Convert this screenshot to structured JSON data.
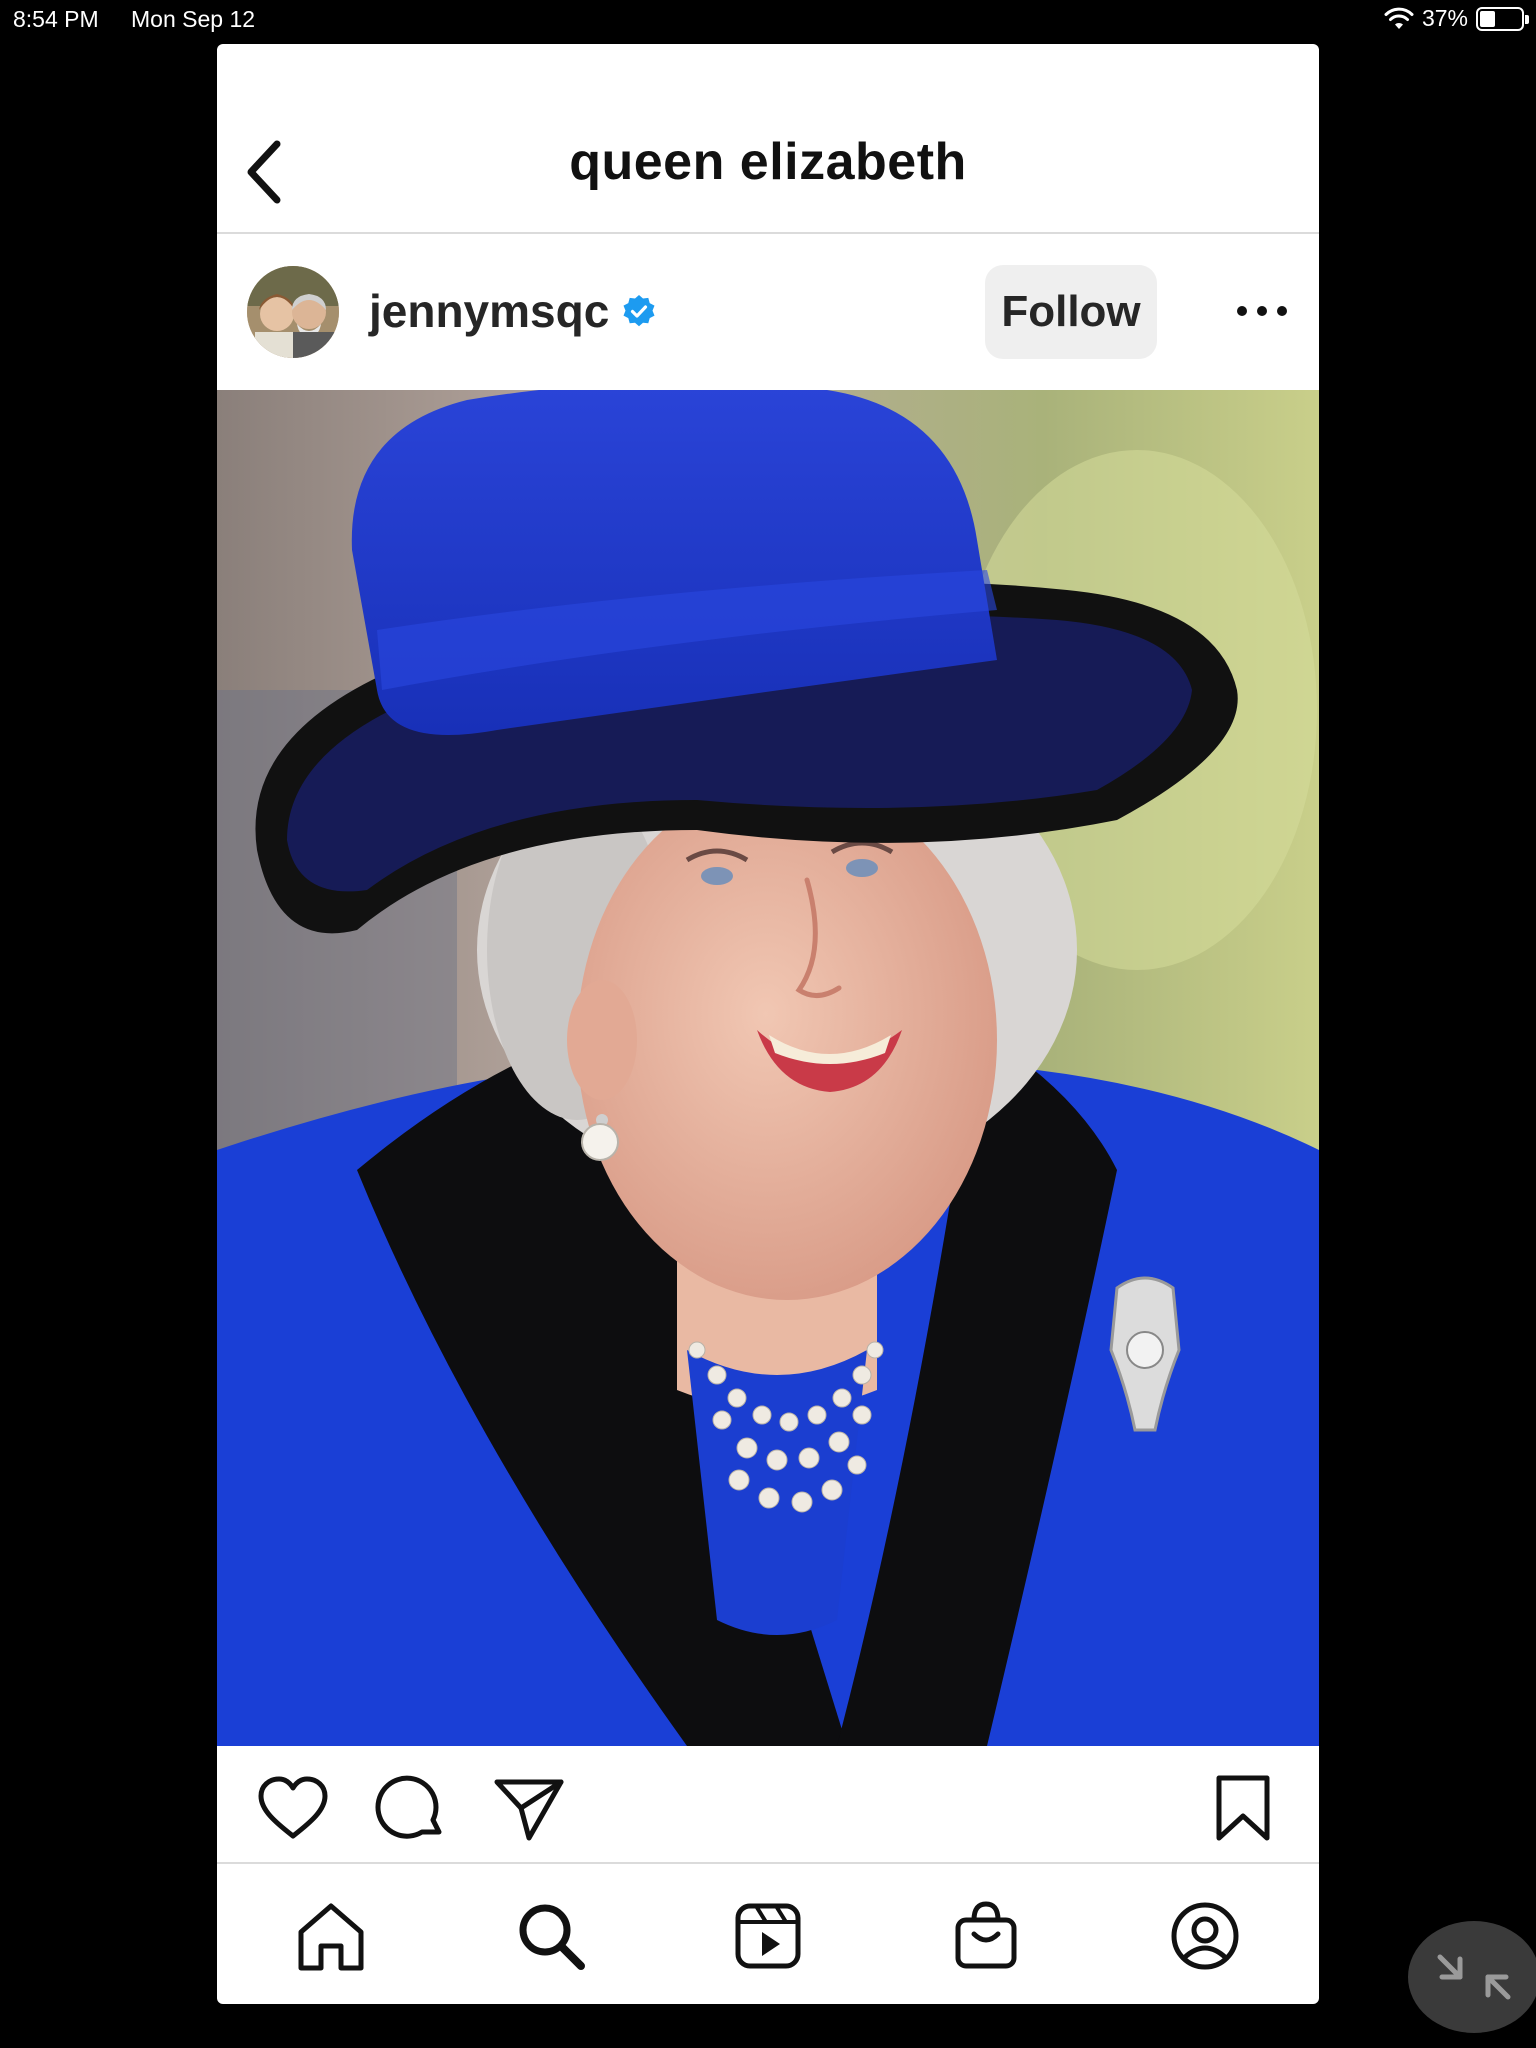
{
  "status_bar": {
    "time": "8:54 PM",
    "date": "Mon Sep 12",
    "battery": "37%",
    "battery_level": 0.37
  },
  "header": {
    "title": "queen elizabeth",
    "back_icon": "chevron-left-icon"
  },
  "post": {
    "username": "jennymsqc",
    "verified": true,
    "follow_label": "Follow",
    "more_icon": "more-horizontal-icon"
  },
  "actions": {
    "like_icon": "heart-icon",
    "comment_icon": "comment-icon",
    "share_icon": "send-icon",
    "save_icon": "bookmark-icon"
  },
  "tab_bar": {
    "items": [
      "home-icon",
      "search-icon",
      "reels-icon",
      "shop-icon",
      "profile-icon"
    ]
  },
  "colors": {
    "verified_blue": "#1d9bf0",
    "coat_blue": "#1a3fd6",
    "hat_brim": "#111111"
  }
}
